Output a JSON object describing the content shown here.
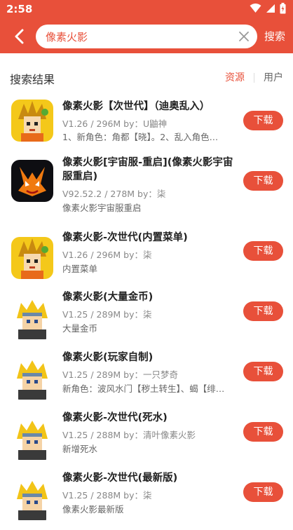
{
  "status": {
    "time": "2:58"
  },
  "search": {
    "value": "像素火影",
    "button": "搜索"
  },
  "results": {
    "title": "搜索结果",
    "tab_resource": "资源",
    "tab_user": "用户"
  },
  "download_label": "下载",
  "items": [
    {
      "name": "像素火影【次世代】（迪奥乱入）",
      "meta": "V1.26 / 296M  by：U鼬神",
      "desc": "1、新角色：角都【晓】。2、乱入角色…",
      "icon": "naruto-gold"
    },
    {
      "name": "像素火影[宇宙服-重启](像素火影宇宙服重启)",
      "meta": "V92.52.2 / 278M  by：柒",
      "desc": "像素火影宇宙服重启",
      "icon": "kurama-dark"
    },
    {
      "name": "像素火影-次世代(内置菜单)",
      "meta": "V1.26 / 296M  by：柒",
      "desc": "内置菜单",
      "icon": "naruto-gold"
    },
    {
      "name": "像素火影(大量金币)",
      "meta": "V1.25 / 289M  by：柒",
      "desc": "大量金币",
      "icon": "minato-blonde"
    },
    {
      "name": "像素火影(玩家自制)",
      "meta": "V1.25 / 289M  by：一只梦奇",
      "desc": "新角色：波风水门【秽土转生】、蝎【绯…",
      "icon": "minato-blonde"
    },
    {
      "name": "像素火影-次世代(死水)",
      "meta": "V1.25 / 288M  by：清叶像素火影",
      "desc": "新增死水",
      "icon": "minato-blonde"
    },
    {
      "name": "像素火影-次世代(最新版)",
      "meta": "V1.25 / 288M  by：柒",
      "desc": "像素火影最新版",
      "icon": "minato-blonde"
    }
  ]
}
